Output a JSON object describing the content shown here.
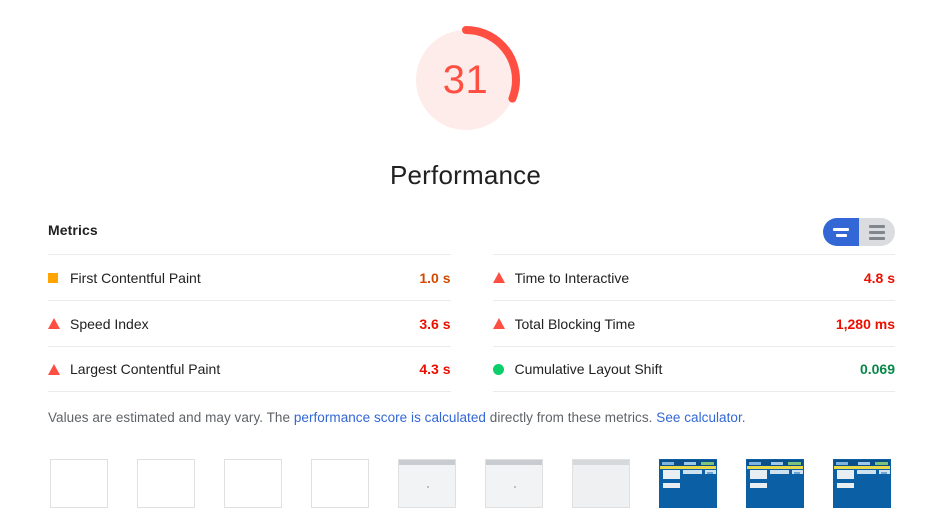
{
  "gauge": {
    "score": "31",
    "category_title": "Performance",
    "arc_color": "#ff4e42",
    "track_color": "#fdecea",
    "percent": 31
  },
  "metrics": {
    "heading": "Metrics",
    "toggle": {
      "filmstrip_view_label": "filmstrip-view",
      "list_view_label": "list-view",
      "active_color": "#3367d6",
      "inactive_color": "#dadce0"
    },
    "left_column": [
      {
        "icon": "square-orange",
        "label": "First Contentful Paint",
        "value": "1.0 s",
        "rating": "average"
      },
      {
        "icon": "triangle-red",
        "label": "Speed Index",
        "value": "3.6 s",
        "rating": "fail"
      },
      {
        "icon": "triangle-red",
        "label": "Largest Contentful Paint",
        "value": "4.3 s",
        "rating": "fail"
      }
    ],
    "right_column": [
      {
        "icon": "triangle-red",
        "label": "Time to Interactive",
        "value": "4.8 s",
        "rating": "fail"
      },
      {
        "icon": "triangle-red",
        "label": "Total Blocking Time",
        "value": "1,280 ms",
        "rating": "fail"
      },
      {
        "icon": "circle-green",
        "label": "Cumulative Layout Shift",
        "value": "0.069",
        "rating": "pass"
      }
    ],
    "rating_colors": {
      "average": "#d04b00",
      "fail": "#eb0f00",
      "pass": "#068849",
      "square": "#ffa400",
      "triangle": "#ff4e42",
      "circle": "#0cce6b"
    }
  },
  "note": {
    "text_before": "Values are estimated and may vary. The ",
    "link_score": "performance score is calculated",
    "text_middle": " directly from these metrics. ",
    "link_calculator": "See calculator.",
    "link_color": "#3367d6"
  },
  "filmstrip": {
    "frames": [
      {
        "state": "blank"
      },
      {
        "state": "blank"
      },
      {
        "state": "blank"
      },
      {
        "state": "blank"
      },
      {
        "state": "chrome"
      },
      {
        "state": "chrome"
      },
      {
        "state": "chrome2"
      },
      {
        "state": "loaded"
      },
      {
        "state": "loaded"
      },
      {
        "state": "loaded"
      }
    ]
  }
}
